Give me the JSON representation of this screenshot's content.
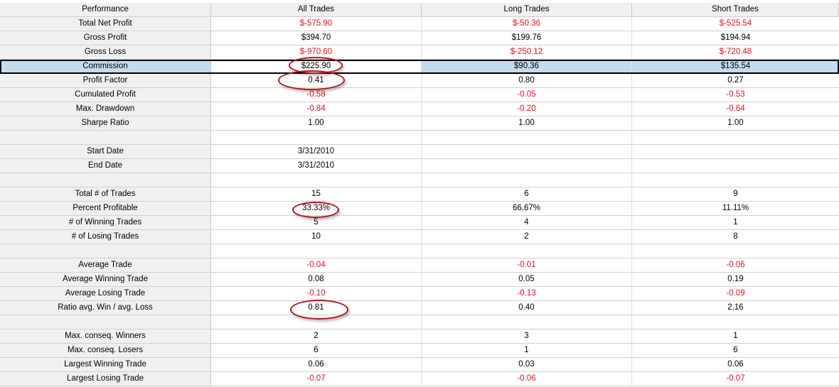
{
  "columns": [
    "Performance",
    "All Trades",
    "Long Trades",
    "Short Trades"
  ],
  "rows": [
    {
      "label": "Total Net Profit",
      "values": [
        "$-575.90",
        "$-50.36",
        "$-525.54"
      ],
      "neg": [
        true,
        true,
        true
      ]
    },
    {
      "label": "Gross Profit",
      "values": [
        "$394.70",
        "$199.76",
        "$194.94"
      ],
      "neg": [
        false,
        false,
        false
      ]
    },
    {
      "label": "Gross Loss",
      "values": [
        "$-970.60",
        "$-250.12",
        "$-720.48"
      ],
      "neg": [
        true,
        true,
        true
      ]
    },
    {
      "label": "Commission",
      "values": [
        "$225.90",
        "$90.36",
        "$135.54"
      ],
      "neg": [
        false,
        false,
        false
      ],
      "selected": true
    },
    {
      "label": "Profit Factor",
      "values": [
        "0.41",
        "0.80",
        "0.27"
      ],
      "neg": [
        false,
        false,
        false
      ]
    },
    {
      "label": "Cumulated Profit",
      "values": [
        "-0.58",
        "-0.05",
        "-0.53"
      ],
      "neg": [
        true,
        true,
        true
      ]
    },
    {
      "label": "Max. Drawdown",
      "values": [
        "-0.84",
        "-0.20",
        "-0.64"
      ],
      "neg": [
        true,
        true,
        true
      ]
    },
    {
      "label": "Sharpe Ratio",
      "values": [
        "1.00",
        "1.00",
        "1.00"
      ],
      "neg": [
        false,
        false,
        false
      ]
    },
    {
      "label": "",
      "values": [
        "",
        "",
        ""
      ],
      "neg": [
        false,
        false,
        false
      ]
    },
    {
      "label": "Start Date",
      "values": [
        "3/31/2010",
        "",
        ""
      ],
      "neg": [
        false,
        false,
        false
      ]
    },
    {
      "label": "End Date",
      "values": [
        "3/31/2010",
        "",
        ""
      ],
      "neg": [
        false,
        false,
        false
      ]
    },
    {
      "label": "",
      "values": [
        "",
        "",
        ""
      ],
      "neg": [
        false,
        false,
        false
      ]
    },
    {
      "label": "Total # of Trades",
      "values": [
        "15",
        "6",
        "9"
      ],
      "neg": [
        false,
        false,
        false
      ]
    },
    {
      "label": "Percent Profitable",
      "values": [
        "33.33%",
        "66.67%",
        "11.11%"
      ],
      "neg": [
        false,
        false,
        false
      ]
    },
    {
      "label": "# of Winning Trades",
      "values": [
        "5",
        "4",
        "1"
      ],
      "neg": [
        false,
        false,
        false
      ]
    },
    {
      "label": "# of Losing Trades",
      "values": [
        "10",
        "2",
        "8"
      ],
      "neg": [
        false,
        false,
        false
      ]
    },
    {
      "label": "",
      "values": [
        "",
        "",
        ""
      ],
      "neg": [
        false,
        false,
        false
      ]
    },
    {
      "label": "Average Trade",
      "values": [
        "-0.04",
        "-0.01",
        "-0.06"
      ],
      "neg": [
        true,
        true,
        true
      ]
    },
    {
      "label": "Average Winning Trade",
      "values": [
        "0.08",
        "0.05",
        "0.19"
      ],
      "neg": [
        false,
        false,
        false
      ]
    },
    {
      "label": "Average Losing Trade",
      "values": [
        "-0.10",
        "-0.13",
        "-0.09"
      ],
      "neg": [
        true,
        true,
        true
      ]
    },
    {
      "label": "Ratio avg. Win / avg. Loss",
      "values": [
        "0.81",
        "0.40",
        "2.16"
      ],
      "neg": [
        false,
        false,
        false
      ]
    },
    {
      "label": "",
      "values": [
        "",
        "",
        ""
      ],
      "neg": [
        false,
        false,
        false
      ]
    },
    {
      "label": "Max. conseq. Winners",
      "values": [
        "2",
        "3",
        "1"
      ],
      "neg": [
        false,
        false,
        false
      ]
    },
    {
      "label": "Max. conseq. Losers",
      "values": [
        "6",
        "1",
        "6"
      ],
      "neg": [
        false,
        false,
        false
      ]
    },
    {
      "label": "Largest Winning Trade",
      "values": [
        "0.06",
        "0.03",
        "0.06"
      ],
      "neg": [
        false,
        false,
        false
      ]
    },
    {
      "label": "Largest Losing Trade",
      "values": [
        "-0.07",
        "-0.06",
        "-0.07"
      ],
      "neg": [
        true,
        true,
        true
      ]
    }
  ],
  "colors": {
    "negative": "#e8151b",
    "selection": "#c2dcf2",
    "annotation": "#b0141c"
  },
  "annotations": [
    "Commission",
    "Profit Factor",
    "Percent Profitable",
    "Ratio avg. Win / avg. Loss"
  ]
}
